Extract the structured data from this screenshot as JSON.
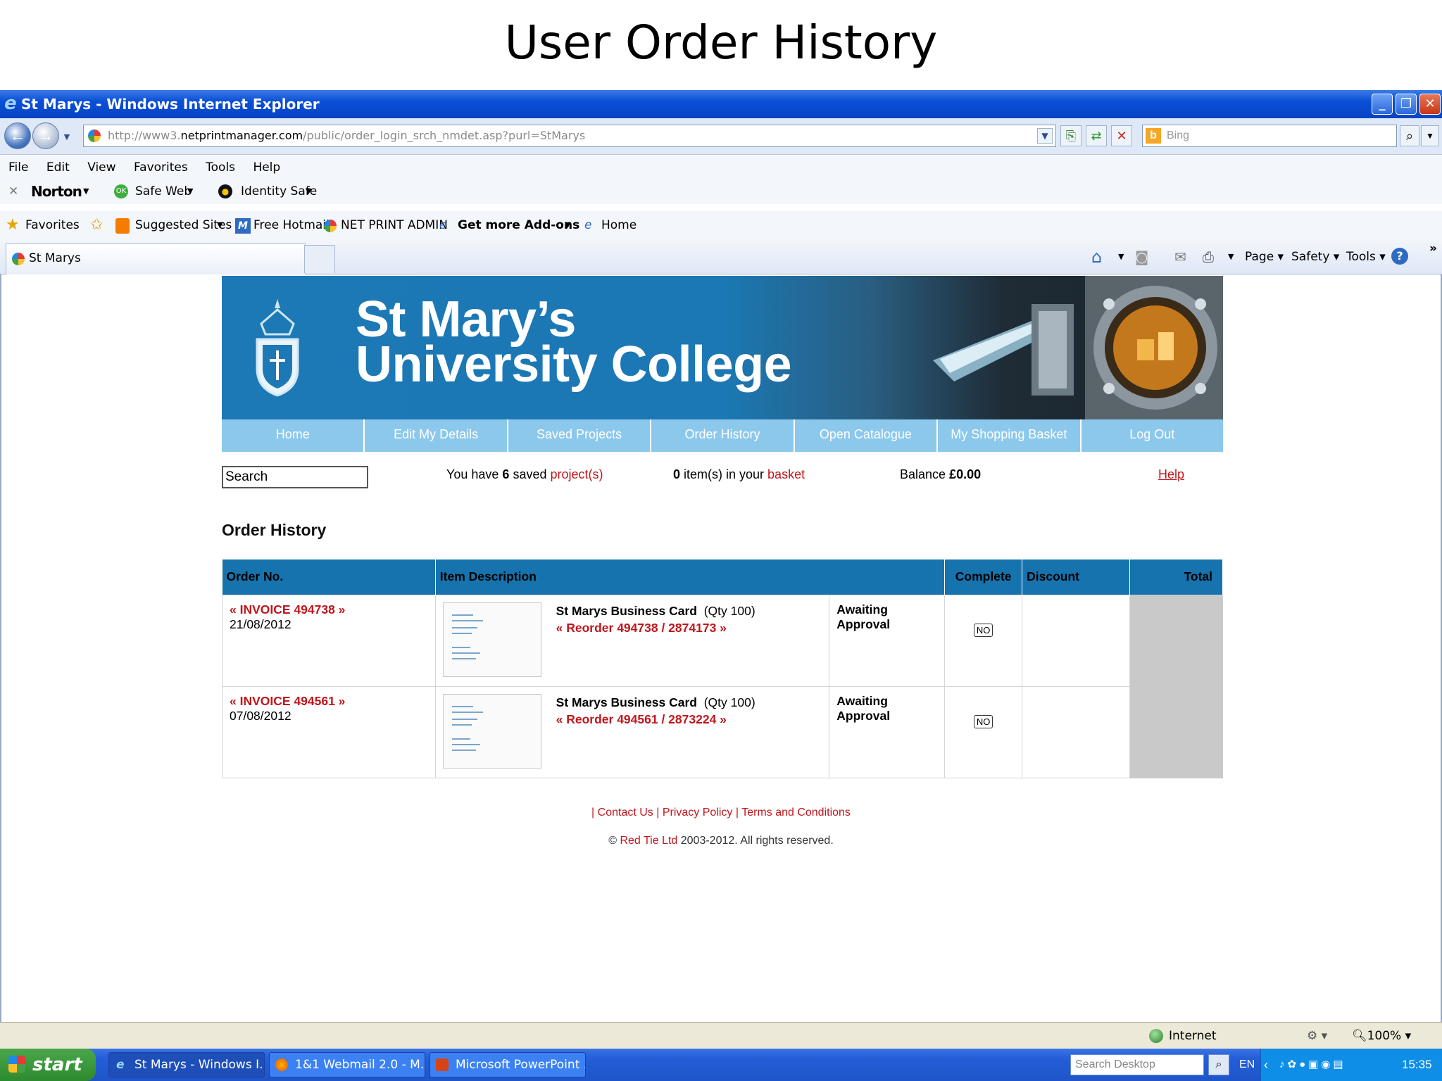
{
  "slide": {
    "title": "User Order History"
  },
  "browser": {
    "window_title": "St Marys - Windows Internet Explorer",
    "url_prefix": "http://www3.",
    "url_domain": "netprintmanager.com",
    "url_path": "/public/order_login_srch_nmdet.asp?purl=StMarys",
    "search_placeholder": "Bing",
    "menu": [
      "File",
      "Edit",
      "View",
      "Favorites",
      "Tools",
      "Help"
    ],
    "norton": {
      "brand": "Norton",
      "safe_web": "Safe Web",
      "identity_safe": "Identity Safe"
    },
    "favorites": {
      "favorites_label": "Favorites",
      "items": [
        "Suggested Sites",
        "Free Hotmail",
        "NET PRINT ADMIN",
        "Get more Add-ons",
        "Home"
      ]
    },
    "tab_label": "St Marys",
    "command_bar": {
      "page": "Page",
      "safety": "Safety",
      "tools": "Tools"
    },
    "status": {
      "zone": "Internet",
      "zoom": "100%"
    }
  },
  "site": {
    "college_name_line1": "St Mary’s",
    "college_name_line2": "University College",
    "nav": [
      "Home",
      "Edit My Details",
      "Saved Projects",
      "Order History",
      "Open Catalogue",
      "My Shopping Basket",
      "Log Out"
    ],
    "search_value": "Search",
    "saved_projects_text": "You have ",
    "saved_projects_count": "6",
    "saved_projects_mid": " saved ",
    "saved_projects_link": "project(s)",
    "basket_count": "0",
    "basket_text": " item(s) in your ",
    "basket_link": "basket",
    "balance_label": "Balance ",
    "balance_value": "£0.00",
    "help": "Help"
  },
  "orders": {
    "heading": "Order History",
    "columns": [
      "Order No.",
      "Item Description",
      "Complete",
      "Discount",
      "Total"
    ],
    "rows": [
      {
        "invoice": "« INVOICE 494738 »",
        "date": "21/08/2012",
        "item": "St Marys Business Card",
        "qty": "(Qty 100)",
        "reorder": "« Reorder 494738 / 2874173 »",
        "status": "Awaiting Approval",
        "complete": "NO"
      },
      {
        "invoice": "« INVOICE 494561 »",
        "date": "07/08/2012",
        "item": "St Marys Business Card",
        "qty": "(Qty 100)",
        "reorder": "« Reorder 494561 / 2873224 »",
        "status": "Awaiting Approval",
        "complete": "NO"
      }
    ]
  },
  "footer": {
    "contact": "Contact Us",
    "privacy": "Privacy Policy",
    "terms": "Terms and Conditions",
    "copyright_prefix": "© ",
    "company": "Red Tie Ltd",
    "copyright_suffix": " 2003-2012. All rights reserved."
  },
  "taskbar": {
    "start": "start",
    "tasks": [
      "St Marys - Windows I...",
      "1&1 Webmail 2.0 - M...",
      "Microsoft PowerPoint ..."
    ],
    "desktop_search": "Search Desktop",
    "lang": "EN",
    "clock": "15:35"
  },
  "colors": {
    "header_blue": "#1c79b6",
    "nav_blue": "#8cc8ec",
    "table_header": "#1673ad",
    "link_red": "#c0161c"
  }
}
